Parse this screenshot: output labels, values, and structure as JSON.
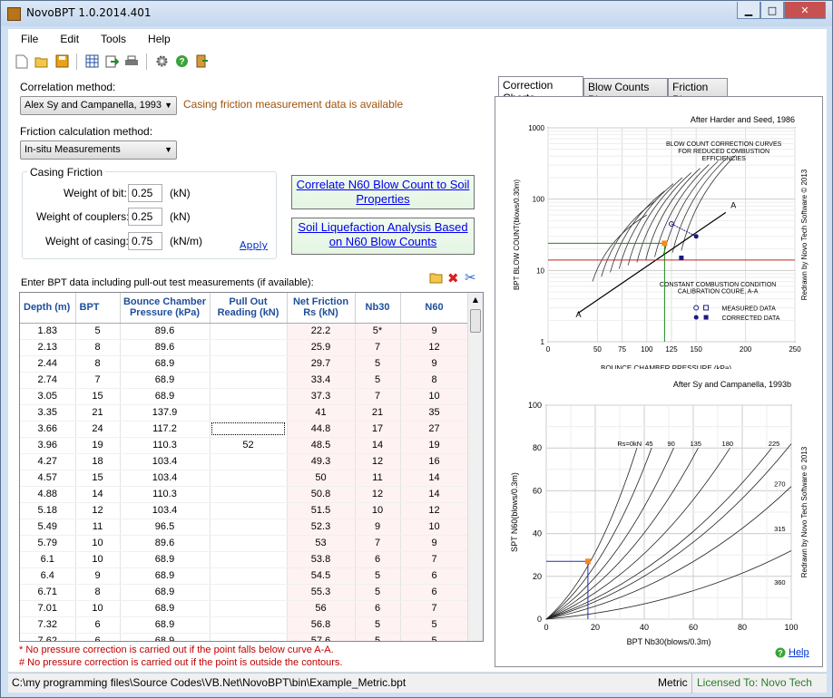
{
  "window": {
    "title": "NovoBPT 1.0.2014.401",
    "minimize": "▁",
    "maximize": "□",
    "close": "✕"
  },
  "menu": [
    "File",
    "Edit",
    "Tools",
    "Help"
  ],
  "toolbar_icons": [
    "new-file-icon",
    "open-folder-icon",
    "save-icon",
    "table-icon",
    "export-icon",
    "print-icon",
    "settings-icon",
    "help-icon",
    "exit-icon"
  ],
  "correlation": {
    "label": "Correlation method:",
    "value": "Alex Sy and Campanella, 1993",
    "status": "Casing friction measurement data is available"
  },
  "friction": {
    "label": "Friction calculation method:",
    "value": "In-situ Measurements"
  },
  "casing": {
    "title": "Casing Friction",
    "bit_label": "Weight of bit:",
    "bit_value": "0.25",
    "bit_unit": "(kN)",
    "couplers_label": "Weight of couplers:",
    "couplers_value": "0.25",
    "couplers_unit": "(kN)",
    "casing_label": "Weight of casing:",
    "casing_value": "0.75",
    "casing_unit": "(kN/m)",
    "apply": "Apply"
  },
  "buttons": {
    "correlate": "Correlate N60 Blow Count to Soil Properties",
    "liquefaction": "Soil Liquefaction Analysis Based on N60 Blow Counts"
  },
  "grid": {
    "caption": "Enter BPT data including pull-out test measurements (if available):",
    "headers": [
      "Depth (m)",
      "BPT",
      "Bounce Chamber Pressure (kPa)",
      "Pull Out Reading (kN)",
      "Net Friction Rs (kN)",
      "Nb30",
      "N60"
    ],
    "rows": [
      [
        "1.83",
        "5",
        "89.6",
        "",
        "22.2",
        "5*",
        "9"
      ],
      [
        "2.13",
        "8",
        "89.6",
        "",
        "25.9",
        "7",
        "12"
      ],
      [
        "2.44",
        "8",
        "68.9",
        "",
        "29.7",
        "5",
        "9"
      ],
      [
        "2.74",
        "7",
        "68.9",
        "",
        "33.4",
        "5",
        "8"
      ],
      [
        "3.05",
        "15",
        "68.9",
        "",
        "37.3",
        "7",
        "10"
      ],
      [
        "3.35",
        "21",
        "137.9",
        "",
        "41",
        "21",
        "35"
      ],
      [
        "3.66",
        "24",
        "117.2",
        "",
        "44.8",
        "17",
        "27"
      ],
      [
        "3.96",
        "19",
        "110.3",
        "52",
        "48.5",
        "14",
        "19"
      ],
      [
        "4.27",
        "18",
        "103.4",
        "",
        "49.3",
        "12",
        "16"
      ],
      [
        "4.57",
        "15",
        "103.4",
        "",
        "50",
        "11",
        "14"
      ],
      [
        "4.88",
        "14",
        "110.3",
        "",
        "50.8",
        "12",
        "14"
      ],
      [
        "5.18",
        "12",
        "103.4",
        "",
        "51.5",
        "10",
        "12"
      ],
      [
        "5.49",
        "11",
        "96.5",
        "",
        "52.3",
        "9",
        "10"
      ],
      [
        "5.79",
        "10",
        "89.6",
        "",
        "53",
        "7",
        "9"
      ],
      [
        "6.1",
        "10",
        "68.9",
        "",
        "53.8",
        "6",
        "7"
      ],
      [
        "6.4",
        "9",
        "68.9",
        "",
        "54.5",
        "5",
        "6"
      ],
      [
        "6.71",
        "8",
        "68.9",
        "",
        "55.3",
        "5",
        "6"
      ],
      [
        "7.01",
        "10",
        "68.9",
        "",
        "56",
        "6",
        "7"
      ],
      [
        "7.32",
        "6",
        "68.9",
        "",
        "56.8",
        "5",
        "5"
      ],
      [
        "7.62",
        "6",
        "68.9",
        "",
        "57.6",
        "5",
        "5"
      ]
    ]
  },
  "notes": [
    "* No pressure correction is carried out if the point falls below curve A-A.",
    "# No pressure correction is carried out if the point is outside the contours."
  ],
  "tabs": [
    "Correction Charts",
    "Blow Counts Plot",
    "Friction Plot"
  ],
  "chart1": {
    "source": "After Harder and Seed, 1986",
    "ylabel": "BPT BLOW COUNT(blows/0.30m)",
    "xlabel": "BOUNCE CHAMBER PRESSURE (kPa)",
    "yticks": [
      "1000",
      "100",
      "10",
      "1"
    ],
    "xticks": [
      "0",
      "50",
      "75",
      "100",
      "125",
      "150",
      "200",
      "250"
    ],
    "note1": "BLOW COUNT CORRECTION CURVES",
    "note2": "FOR REDUCED COMBUSTION",
    "note3": "EFFICIENCIES",
    "note4": "CONSTANT COMBUSTION CONDITION",
    "note5": "CALIBRATION COURE, A-A",
    "curve_label_a": "A",
    "legend1": "MEASURED DATA",
    "legend2": "CORRECTED DATA",
    "credit": "Redrawn by Novo Tech Software © 2013"
  },
  "chart2": {
    "source": "After Sy and Campanella, 1993b",
    "ylabel": "SPT N60(blows/0.3m)",
    "xlabel": "BPT Nb30(blows/0.3m)",
    "yticks": [
      "100",
      "80",
      "60",
      "40",
      "20",
      "0"
    ],
    "xticks": [
      "0",
      "20",
      "40",
      "60",
      "80",
      "100"
    ],
    "curve_labels": [
      "Rs=0kN",
      "45",
      "90",
      "135",
      "180",
      "225",
      "270",
      "315",
      "360"
    ],
    "credit": "Redrawn by Novo Tech Software © 2013"
  },
  "help": "Help",
  "status": {
    "path": "C:\\my programming files\\Source Codes\\VB.Net\\NovoBPT\\bin\\Example_Metric.bpt",
    "units": "Metric",
    "license": "Licensed To: Novo Tech"
  },
  "colors": {
    "header_text": "#1e4e9b",
    "note": "#c00000",
    "license": "#2a7d2a",
    "marker": "#f28c1e"
  }
}
